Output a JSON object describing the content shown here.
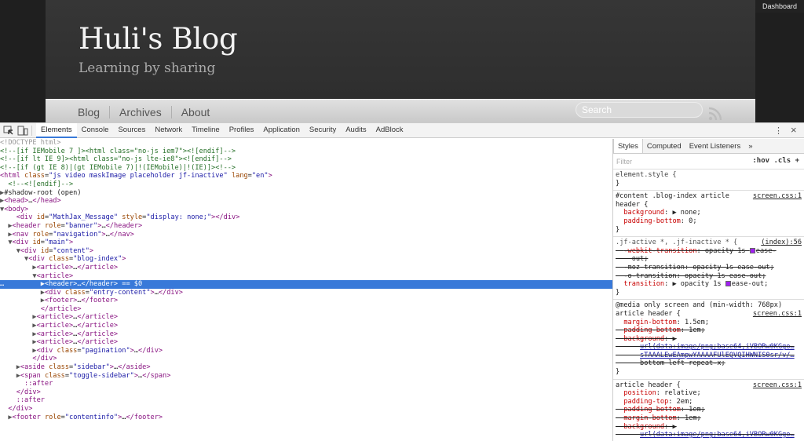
{
  "blog": {
    "title": "Huli's Blog",
    "subtitle": "Learning by sharing",
    "nav": [
      "Blog",
      "Archives",
      "About"
    ],
    "search_placeholder": "Search",
    "dashboard": "Dashboard"
  },
  "devtools": {
    "tabs": [
      "Elements",
      "Console",
      "Sources",
      "Network",
      "Timeline",
      "Profiles",
      "Application",
      "Security",
      "Audits",
      "AdBlock"
    ],
    "active_tab": "Elements",
    "styles_tabs": [
      "Styles",
      "Computed",
      "Event Listeners",
      "»"
    ],
    "filter_placeholder": "Filter",
    "filter_buttons": ":hov  .cls  +"
  },
  "colors": {
    "selected_row": "#3879d9",
    "tag": "#881280",
    "attr": "#994500",
    "value": "#1a1aa6",
    "comment": "#236e25"
  }
}
